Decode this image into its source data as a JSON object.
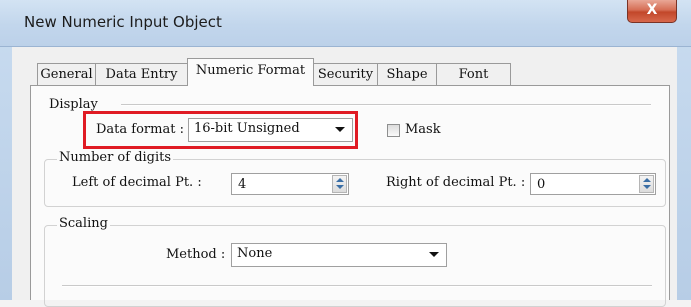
{
  "window": {
    "title": "New Numeric Input Object",
    "close_label": "X"
  },
  "tabs": [
    {
      "label": "General",
      "active": false
    },
    {
      "label": "Data Entry",
      "active": false
    },
    {
      "label": "Numeric Format",
      "active": true
    },
    {
      "label": "Security",
      "active": false
    },
    {
      "label": "Shape",
      "active": false
    },
    {
      "label": "Font",
      "active": false
    }
  ],
  "display": {
    "group_label": "Display",
    "data_format_label": "Data format :",
    "data_format_value": "16-bit Unsigned",
    "mask_label": "Mask",
    "mask_checked": false
  },
  "digits": {
    "group_label": "Number of digits",
    "left_label": "Left of decimal Pt. :",
    "left_value": "4",
    "right_label": "Right of decimal Pt. :",
    "right_value": "0"
  },
  "scaling": {
    "group_label": "Scaling",
    "method_label": "Method :",
    "method_value": "None"
  },
  "colors": {
    "highlight": "#e01b24",
    "spin_arrow": "#3a6ea5"
  },
  "icons": {
    "close": "close-icon",
    "dropdown": "chevron-down-icon",
    "spin": "spinner-arrows-icon"
  }
}
